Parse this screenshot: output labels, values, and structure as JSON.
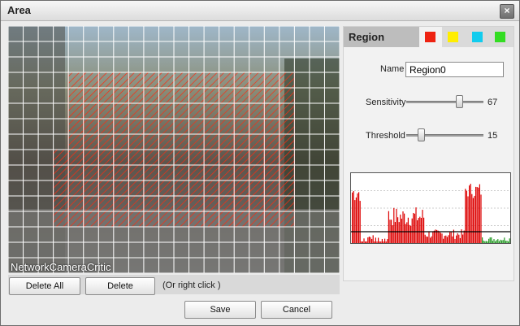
{
  "window": {
    "title": "Area",
    "close_label": "×"
  },
  "video": {
    "watermark": "NetworkCameraCritic"
  },
  "region_panel": {
    "tab_label": "Region",
    "color_tabs": [
      {
        "name": "red",
        "color": "#ee2211"
      },
      {
        "name": "yellow",
        "color": "#ffee00"
      },
      {
        "name": "cyan",
        "color": "#11ccee"
      },
      {
        "name": "green",
        "color": "#33dd22"
      }
    ],
    "name_label": "Name",
    "name_value": "Region0",
    "sensitivity_label": "Sensitivity",
    "sensitivity_value": "67",
    "threshold_label": "Threshold",
    "threshold_value": "15"
  },
  "buttons": {
    "delete_all": "Delete All",
    "delete": "Delete",
    "hint": "(Or right click )",
    "save": "Save",
    "cancel": "Cancel"
  },
  "colors": {
    "grid": "#ffffff",
    "region": "#ee1100",
    "histogram_bar": "#dd0000",
    "histogram_low": "#229922"
  }
}
